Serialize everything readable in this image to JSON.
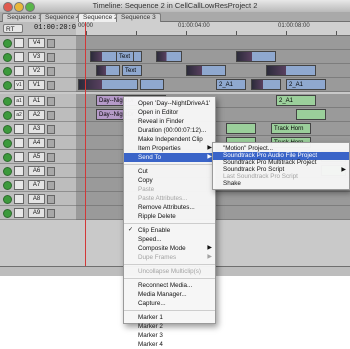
{
  "window": {
    "title": "Timeline: Sequence 2 in CellCallLowResProject 2"
  },
  "tabs": [
    "Sequence 1",
    "Sequence 4",
    "Sequence 2",
    "Sequence 3"
  ],
  "active_tab_index": 2,
  "toolbar": {
    "render_select": "RT",
    "timecode": "01:00:20:03"
  },
  "ruler": {
    "labels": [
      "00:00",
      "01:00:04:00",
      "01:00:08:00"
    ]
  },
  "video_tracks": [
    {
      "name": "V4"
    },
    {
      "name": "V3"
    },
    {
      "name": "V2"
    },
    {
      "name": "V1",
      "source": "v1"
    }
  ],
  "audio_tracks": [
    {
      "name": "A1",
      "source": "a1"
    },
    {
      "name": "A2",
      "source": "a2"
    },
    {
      "name": "A3"
    },
    {
      "name": "A4"
    },
    {
      "name": "A5"
    },
    {
      "name": "A6"
    },
    {
      "name": "A7"
    },
    {
      "name": "A8"
    },
    {
      "name": "A9"
    }
  ],
  "clips": {
    "v3_text": "Text",
    "v2_text": "Text",
    "v1_a": "2_A1",
    "v1_b": "2_A1",
    "a1_clip": "Day--NightDr",
    "a2_clip": "Day--NightDr",
    "a1_right": "2_A1",
    "a2_right": "Track Horn",
    "a3_right": "Truck Horn"
  },
  "context_menu": {
    "items": [
      {
        "label": "Open 'Day--NightDriveA1'",
        "enabled": true
      },
      {
        "label": "Open in Editor",
        "enabled": true
      },
      {
        "label": "Reveal in Finder",
        "enabled": true
      },
      {
        "label": "Duration (00:00:07:12)...",
        "enabled": true
      },
      {
        "label": "Make Independent Clip",
        "enabled": true
      },
      {
        "label": "Item Properties",
        "enabled": true,
        "submenu": true
      },
      {
        "label": "Send To",
        "enabled": true,
        "submenu": true,
        "highlighted": true
      },
      {
        "separator": true
      },
      {
        "label": "Cut",
        "enabled": true
      },
      {
        "label": "Copy",
        "enabled": true
      },
      {
        "label": "Paste",
        "enabled": false
      },
      {
        "label": "Paste Attributes...",
        "enabled": false
      },
      {
        "label": "Remove Attributes...",
        "enabled": true
      },
      {
        "label": "Ripple Delete",
        "enabled": true
      },
      {
        "separator": true
      },
      {
        "label": "Clip Enable",
        "enabled": true,
        "checked": true
      },
      {
        "label": "Speed...",
        "enabled": true
      },
      {
        "label": "Composite Mode",
        "enabled": true,
        "submenu": true
      },
      {
        "label": "Dupe Frames",
        "enabled": false,
        "submenu": true
      },
      {
        "separator": true
      },
      {
        "label": "Uncollapse Multiclip(s)",
        "enabled": false
      },
      {
        "separator": true
      },
      {
        "label": "Reconnect Media...",
        "enabled": true
      },
      {
        "label": "Media Manager...",
        "enabled": true
      },
      {
        "label": "Capture...",
        "enabled": true
      },
      {
        "separator": true
      },
      {
        "label": "Marker 1",
        "enabled": true
      },
      {
        "label": "Marker 2",
        "enabled": true
      },
      {
        "label": "Marker 3",
        "enabled": true
      },
      {
        "label": "Marker 4",
        "enabled": true
      }
    ]
  },
  "send_to_submenu": {
    "items": [
      {
        "label": "\"Motion\" Project...",
        "enabled": true
      },
      {
        "label": "Soundtrack Pro Audio File Project",
        "enabled": true,
        "highlighted": true
      },
      {
        "label": "Soundtrack Pro Multitrack Project",
        "enabled": true
      },
      {
        "label": "Soundtrack Pro Script",
        "enabled": true,
        "submenu": true
      },
      {
        "label": "Last Soundtrack Pro Script",
        "enabled": false
      },
      {
        "label": "Shake",
        "enabled": true
      }
    ]
  },
  "colors": {
    "highlight": "#3a64c8",
    "video_clip": "#8fa8cf",
    "audio_clip": "#9bcf9b",
    "playhead": "#d23838"
  }
}
